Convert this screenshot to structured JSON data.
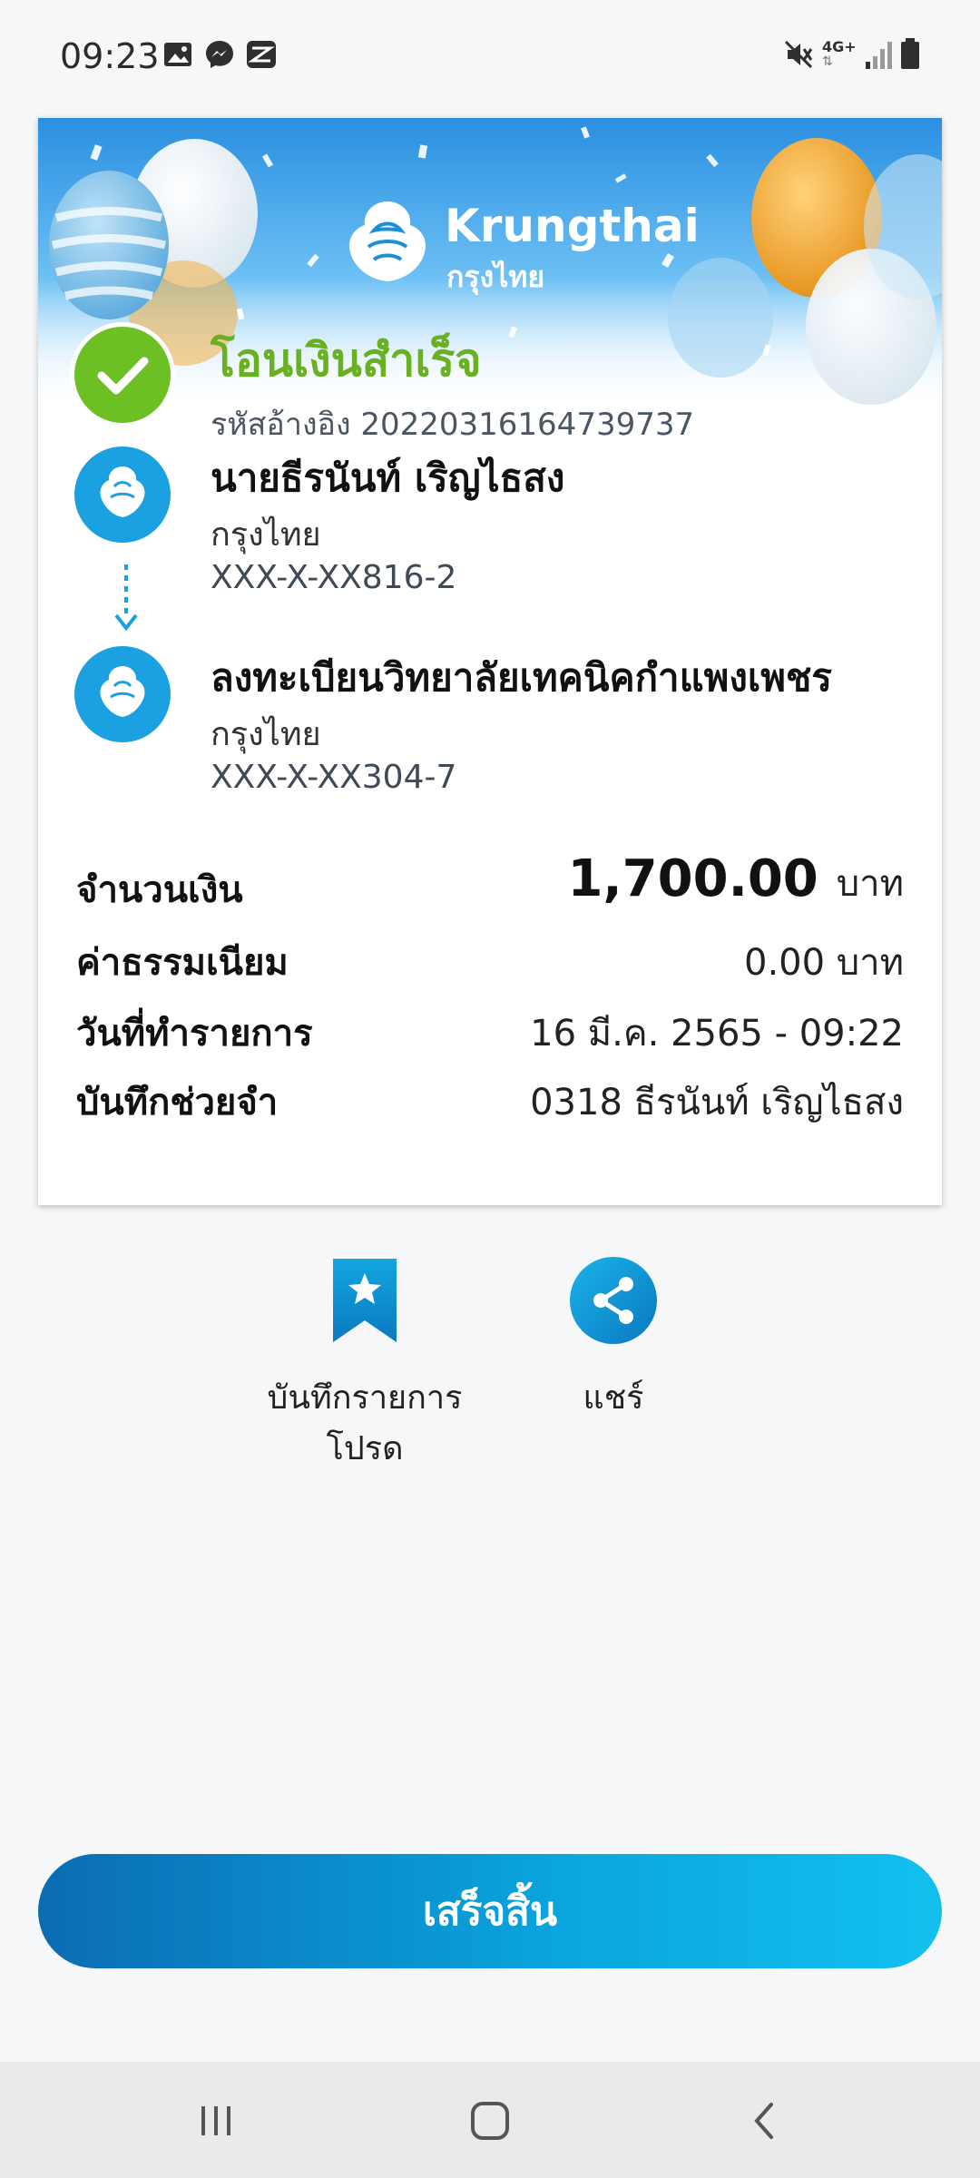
{
  "status_bar": {
    "time": "09:23",
    "left_icons": [
      "image-icon",
      "messenger-icon",
      "capcut-icon"
    ],
    "right_icons": [
      "mute-icon",
      "network-4g-icon",
      "signal-icon",
      "battery-icon"
    ],
    "network_label": "4G+"
  },
  "receipt": {
    "brand": {
      "name_en": "Krungthai",
      "name_th": "กรุงไทย"
    },
    "status_title": "โอนเงินสำเร็จ",
    "reference": "รหัสอ้างอิง 2022031616473973​7",
    "sender": {
      "name": "นายธีรนันท์ เริญไธสง",
      "bank": "กรุงไทย",
      "account": "XXX-X-XX816-2"
    },
    "recipient": {
      "name": "ลงทะเบียนวิทยาลัยเทคนิคกำแพงเพชร",
      "bank": "กรุงไทย",
      "account": "XXX-X-XX304-7"
    },
    "rows": {
      "amount_label": "จำนวนเงิน",
      "amount_value": "1,700.00",
      "amount_unit": "บาท",
      "fee_label": "ค่าธรรมเนียม",
      "fee_value": "0.00 บาท",
      "date_label": "วันที่ทำรายการ",
      "date_value": "16 มี.ค. 2565 - 09:22",
      "memo_label": "บันทึกช่วยจำ",
      "memo_value": "0318 ธีรนันท์ เริญไธสง"
    }
  },
  "actions": {
    "favorite_label_1": "บันทึกรายการ",
    "favorite_label_2": "โปรด",
    "share_label": "แชร์"
  },
  "done_button": "เสร็จสิ้น",
  "colors": {
    "success_green": "#6cc024",
    "brand_blue": "#1ba1e2",
    "button_gradient_start": "#0b6cb3",
    "button_gradient_end": "#12c0ee"
  }
}
